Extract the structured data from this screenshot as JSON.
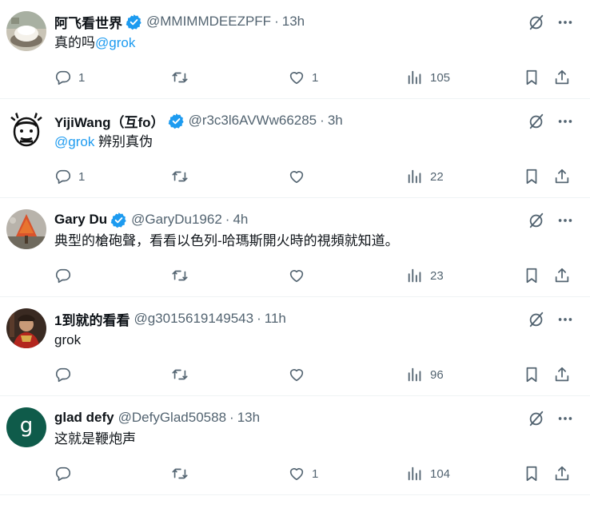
{
  "tweets": [
    {
      "name": "阿飞看世界",
      "handle": "@MMIMMDEEZPFF",
      "dot": "·",
      "time": "13h",
      "text_prefix": "真的吗",
      "mention": "@grok",
      "text_suffix": "",
      "replies": "1",
      "likes": "1",
      "views": "105",
      "avatar": "bowl-photo"
    },
    {
      "name": "YijiWang（互fo）",
      "handle": "@r3c3l6AVWw66285",
      "dot": "·",
      "time": "3h",
      "text_prefix": "",
      "mention": "@grok",
      "text_suffix": " 辨别真伪",
      "replies": "1",
      "likes": "",
      "views": "22",
      "avatar": "cartoon-face"
    },
    {
      "name": "Gary Du",
      "handle": "@GaryDu1962",
      "dot": "·",
      "time": "4h",
      "text_prefix": "典型的槍砲聲，看看以色列-哈瑪斯開火時的視頻就知道。",
      "mention": "",
      "text_suffix": "",
      "replies": "",
      "likes": "",
      "views": "23",
      "avatar": "autumn-tree"
    },
    {
      "name": "1到就的看看",
      "handle": "@g3015619149543",
      "dot": "·",
      "time": "11h",
      "text_prefix": "grok",
      "mention": "",
      "text_suffix": "",
      "replies": "",
      "likes": "",
      "views": "96",
      "avatar": "costume-photo"
    },
    {
      "name": "glad defy",
      "handle": "@DefyGlad50588",
      "dot": "·",
      "time": "13h",
      "text_prefix": "这就是鞭炮声",
      "mention": "",
      "text_suffix": "",
      "replies": "",
      "likes": "1",
      "views": "104",
      "avatar": "letter-g",
      "avatar_letter": "g"
    }
  ],
  "colors": {
    "text": "#0f1419",
    "secondary": "#536471",
    "accent": "#1d9bf0",
    "divider": "#eff3f4",
    "letter_avatar_bg": "#0f5b4a"
  },
  "icons": [
    "verified-icon",
    "grok-icon",
    "more-icon",
    "reply-icon",
    "retweet-icon",
    "like-icon",
    "views-icon",
    "bookmark-icon",
    "share-icon"
  ]
}
